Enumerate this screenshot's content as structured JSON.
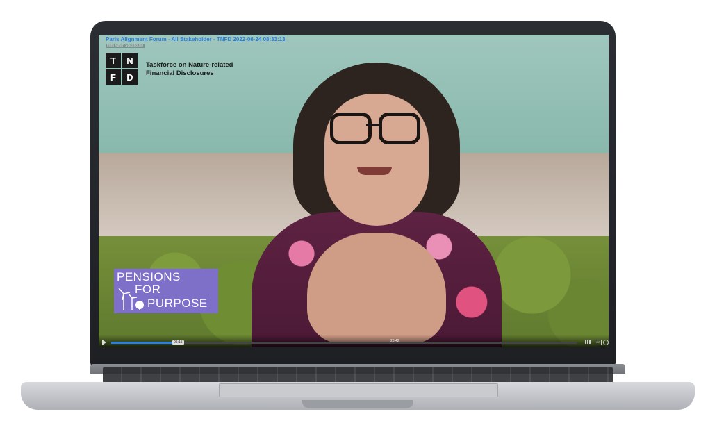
{
  "video": {
    "title": "Paris Alignment Forum - All Stakeholder - TNFD 2022-06-24 08:33:13",
    "from_label": "from Karen Stackhouse",
    "progress_fraction": 0.14,
    "current_time_chip": "05:15",
    "midpoint_time": "23:42"
  },
  "tnfd": {
    "letters": [
      "T",
      "N",
      "F",
      "D"
    ],
    "name_line1": "Taskforce on Nature-related",
    "name_line2": "Financial Disclosures"
  },
  "badge": {
    "line1": "PENSIONS",
    "line2": "FOR",
    "line3": "PURPOSE",
    "color": "#7e70c9"
  },
  "colors": {
    "accent": "#2a7fe0"
  },
  "icons": {
    "play": "play-icon",
    "volume": "volume-icon",
    "captions": "cc-icon",
    "settings": "gear-icon"
  }
}
